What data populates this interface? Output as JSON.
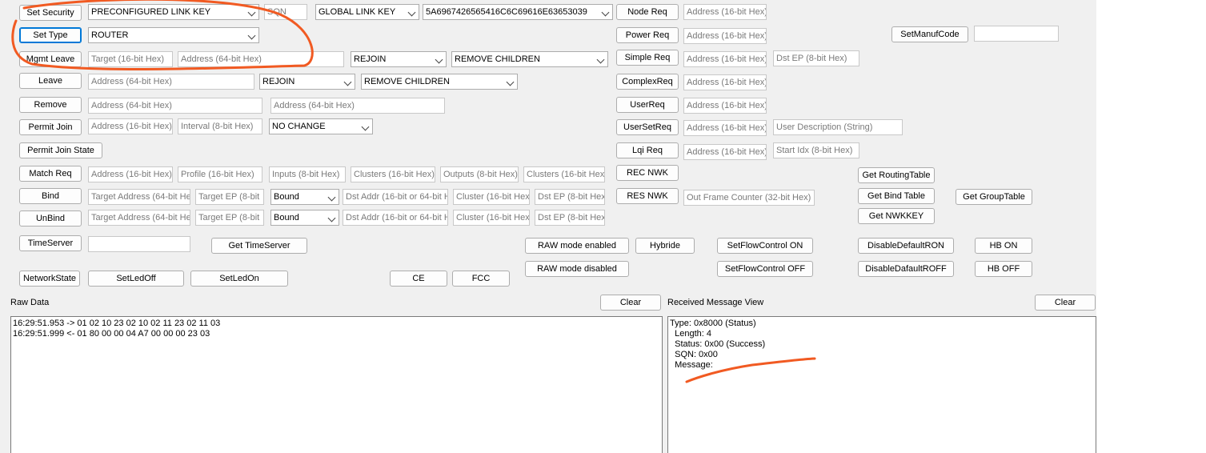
{
  "security": {
    "button": "Set Security",
    "key_type": "PRECONFIGURED LINK KEY",
    "sqn_placeholder": "SQN",
    "global_key": "GLOBAL LINK KEY",
    "key_value": "5A6967426565416C6C69616E63653039"
  },
  "set_type": {
    "button": "Set Type",
    "value": "ROUTER"
  },
  "mgmt_leave": {
    "button": "Mgmt Leave",
    "target_placeholder": "Target (16-bit Hex)",
    "address_placeholder": "Address (64-bit Hex)",
    "rejoin": "REJOIN",
    "children": "REMOVE CHILDREN"
  },
  "leave": {
    "button": "Leave",
    "address_placeholder": "Address (64-bit Hex)",
    "rejoin": "REJOIN",
    "children": "REMOVE CHILDREN"
  },
  "remove": {
    "button": "Remove",
    "address1_placeholder": "Address (64-bit Hex)",
    "address2_placeholder": "Address (64-bit Hex)"
  },
  "permit_join": {
    "button": "Permit Join",
    "address_placeholder": "Address (16-bit Hex)",
    "interval_placeholder": "Interval (8-bit Hex)",
    "change": "NO CHANGE"
  },
  "permit_join_state": {
    "button": "Permit Join State"
  },
  "match_req": {
    "button": "Match Req",
    "address_placeholder": "Address (16-bit Hex)",
    "profile_placeholder": "Profile (16-bit Hex)",
    "inputs_placeholder": "Inputs (8-bit Hex)",
    "clusters_in_placeholder": "Clusters (16-bit Hex)",
    "outputs_placeholder": "Outputs (8-bit Hex)",
    "clusters_out_placeholder": "Clusters (16-bit Hex)"
  },
  "bind": {
    "button": "Bind",
    "target_addr_placeholder": "Target Address (64-bit Hex)",
    "target_ep_placeholder": "Target EP (8-bit",
    "mode": "Bound",
    "dst_addr_placeholder": "Dst Addr (16-bit or 64-bit Hex)",
    "cluster_placeholder": "Cluster (16-bit Hex)",
    "dst_ep_placeholder": "Dst EP (8-bit Hex)"
  },
  "unbind": {
    "button": "UnBind",
    "target_addr_placeholder": "Target Address (64-bit Hex)",
    "target_ep_placeholder": "Target EP (8-bit",
    "mode": "Bound",
    "dst_addr_placeholder": "Dst Addr (16-bit or 64-bit Hex)",
    "cluster_placeholder": "Cluster (16-bit Hex)",
    "dst_ep_placeholder": "Dst EP (8-bit Hex)"
  },
  "time_server": {
    "button": "TimeServer",
    "get_button": "Get TimeServer"
  },
  "network_state": {
    "button": "NetworkState"
  },
  "leds": {
    "off": "SetLedOff",
    "on": "SetLedOn"
  },
  "misc": {
    "ce": "CE",
    "fcc": "FCC",
    "raw_enabled": "RAW mode enabled",
    "raw_disabled": "RAW mode disabled",
    "hybride": "Hybride"
  },
  "flow": {
    "on": "SetFlowControl ON",
    "off": "SetFlowControl OFF"
  },
  "default_rsp": {
    "on": "DisableDefaultRON",
    "off": "DisableDafaultROFF"
  },
  "hb": {
    "on": "HB ON",
    "off": "HB OFF"
  },
  "right_col": {
    "node_req": "Node Req",
    "power_req": "Power Req",
    "simple_req": "Simple Req",
    "complex_req": "ComplexReq",
    "user_req": "UserReq",
    "user_set_req": "UserSetReq",
    "lqi_req": "Lqi Req",
    "rec_nwk": "REC NWK",
    "res_nwk": "RES NWK",
    "address16_placeholder": "Address (16-bit Hex)",
    "dst_ep_placeholder": "Dst EP (8-bit Hex)",
    "user_desc_placeholder": "User Description (String)",
    "start_idx_placeholder": "Start Idx (8-bit Hex)",
    "out_frame_placeholder": "Out Frame Counter (32-bit Hex)"
  },
  "tables": {
    "routing": "Get RoutingTable",
    "bind": "Get Bind Table",
    "group": "Get GroupTable",
    "nwkkey": "Get NWKKEY"
  },
  "manuf": {
    "button": "SetManufCode"
  },
  "raw_data": {
    "label": "Raw Data",
    "clear": "Clear",
    "content": "16:29:51.953 -> 01 02 10 23 02 10 02 11 23 02 11 03\n16:29:51.999 <- 01 80 00 00 04 A7 00 00 00 23 03"
  },
  "received": {
    "label": "Received Message View",
    "clear": "Clear",
    "content": "Type: 0x8000 (Status)\n  Length: 4\n  Status: 0x00 (Success)\n  SQN: 0x00\n  Message:"
  },
  "colors": {
    "annotation": "#f15a22",
    "focus": "#0078d7",
    "panel": "#f0f0f0"
  }
}
